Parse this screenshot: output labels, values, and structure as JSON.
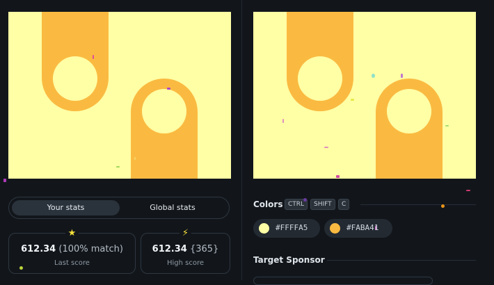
{
  "stats": {
    "tabs": [
      {
        "label": "Your stats",
        "active": true
      },
      {
        "label": "Global stats",
        "active": false
      }
    ],
    "last": {
      "icon": "star-icon",
      "glyph": "★",
      "value": "612.34",
      "detail": "(100% match)",
      "label": "Last score",
      "icon_color": "#f6e03a"
    },
    "high": {
      "icon": "lightning-icon",
      "glyph": "⚡",
      "value": "612.34",
      "detail": "{365}",
      "label": "High score",
      "icon_color": "#f6e03a"
    }
  },
  "colors": {
    "title": "Colors",
    "shortcut": [
      "CTRL",
      "SHIFT",
      "C"
    ],
    "swatches": [
      {
        "hex": "#FFFFA5"
      },
      {
        "hex": "#FABA41"
      }
    ]
  },
  "sponsor": {
    "title": "Target Sponsor"
  },
  "palette": {
    "background": "#ffffa5",
    "shape": "#faba41"
  }
}
